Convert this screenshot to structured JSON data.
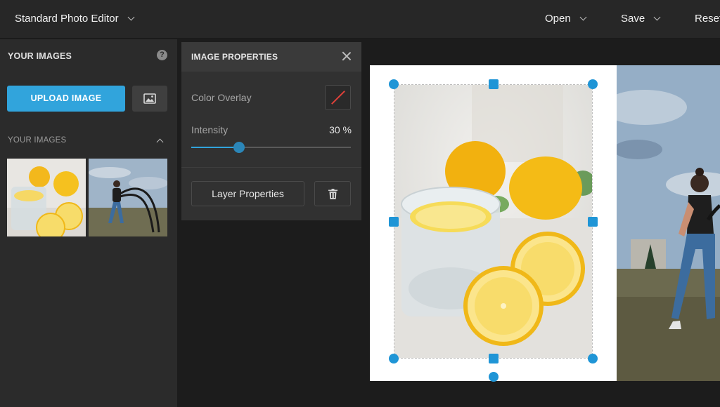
{
  "topbar": {
    "app_title": "Standard Photo Editor",
    "menu": [
      {
        "label": "Open"
      },
      {
        "label": "Save"
      },
      {
        "label": "Reset"
      }
    ]
  },
  "sidebar": {
    "header": "YOUR IMAGES",
    "help_glyph": "?",
    "upload_label": "UPLOAD IMAGE",
    "section_title": "YOUR IMAGES",
    "thumbnails": [
      {
        "subject": "lemons and glass of lemon water"
      },
      {
        "subject": "woman with battle ropes outdoors"
      }
    ]
  },
  "image_properties": {
    "title": "IMAGE PROPERTIES",
    "color_overlay_label": "Color Overlay",
    "intensity_label": "Intensity",
    "intensity_value": "30 %",
    "intensity_fraction": 0.3,
    "layer_button": "Layer Properties"
  },
  "colors": {
    "accent": "#31a4dc",
    "handle": "#1f95d6",
    "overlay_none_slash": "#e0413a",
    "topbar_bg": "#272727",
    "sidebar_bg": "#2b2b2b"
  },
  "icons": {
    "title_dropdown": "chevron-down-icon",
    "stock_images": "image-icon",
    "close": "close-icon",
    "collapse": "chevron-up-icon",
    "delete": "trash-icon",
    "help": "help-icon"
  }
}
